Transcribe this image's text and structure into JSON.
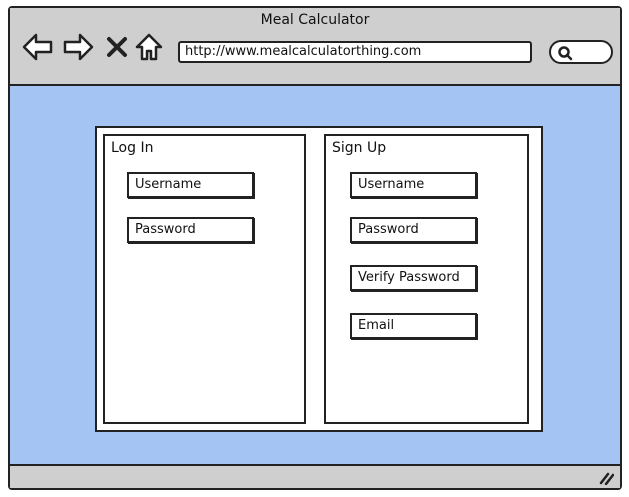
{
  "window": {
    "title": "Meal Calculator"
  },
  "toolbar": {
    "url": "http://www.mealcalculatorthing.com",
    "icons": [
      "back-arrow-icon",
      "forward-arrow-icon",
      "close-icon",
      "home-icon",
      "search-icon"
    ]
  },
  "login": {
    "title": "Log In",
    "fields": [
      "Username",
      "Password"
    ]
  },
  "signup": {
    "title": "Sign Up",
    "fields": [
      "Username",
      "Password",
      "Verify Password",
      "Email"
    ]
  },
  "colors": {
    "content_bg": "#a4c4f4",
    "chrome_bg": "#cfcfcf",
    "stroke": "#222222"
  }
}
